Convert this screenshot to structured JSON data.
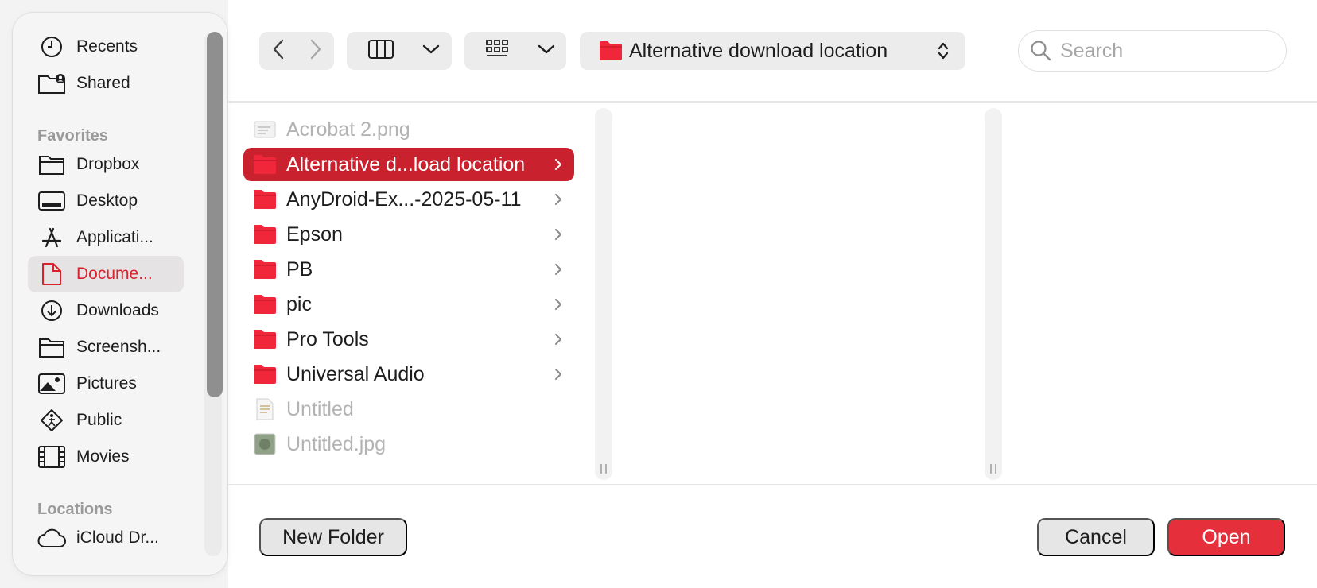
{
  "sidebar": {
    "items_top": [
      {
        "label": "Recents",
        "icon": "clock-icon"
      },
      {
        "label": "Shared",
        "icon": "shared-folder-icon"
      }
    ],
    "favorites_heading": "Favorites",
    "favorites": [
      {
        "label": "Dropbox",
        "icon": "folder-icon"
      },
      {
        "label": "Desktop",
        "icon": "desktop-icon"
      },
      {
        "label": "Applicati...",
        "icon": "applications-icon"
      },
      {
        "label": "Docume...",
        "icon": "document-icon",
        "active": true
      },
      {
        "label": "Downloads",
        "icon": "download-icon"
      },
      {
        "label": "Screensh...",
        "icon": "folder-icon"
      },
      {
        "label": "Pictures",
        "icon": "pictures-icon"
      },
      {
        "label": "Public",
        "icon": "public-icon"
      },
      {
        "label": "Movies",
        "icon": "movies-icon"
      }
    ],
    "locations_heading": "Locations",
    "locations": [
      {
        "label": "iCloud Dr...",
        "icon": "cloud-icon"
      }
    ]
  },
  "toolbar": {
    "path_label": "Alternative download location",
    "search_placeholder": "Search"
  },
  "files": [
    {
      "name": "Acrobat 2.png",
      "kind": "image",
      "dim": true
    },
    {
      "name": "Alternative d...load location",
      "kind": "folder",
      "selected": true
    },
    {
      "name": "AnyDroid-Ex...-2025-05-11",
      "kind": "folder"
    },
    {
      "name": "Epson",
      "kind": "folder"
    },
    {
      "name": "PB",
      "kind": "folder"
    },
    {
      "name": "pic",
      "kind": "folder"
    },
    {
      "name": "Pro Tools",
      "kind": "folder"
    },
    {
      "name": "Universal Audio",
      "kind": "folder"
    },
    {
      "name": "Untitled",
      "kind": "document",
      "dim": true
    },
    {
      "name": "Untitled.jpg",
      "kind": "image",
      "dim": true
    }
  ],
  "buttons": {
    "new_folder": "New Folder",
    "cancel": "Cancel",
    "open": "Open"
  },
  "colors": {
    "accent": "#e5303c",
    "selection": "#c9222e",
    "folder": "#f0263a"
  }
}
